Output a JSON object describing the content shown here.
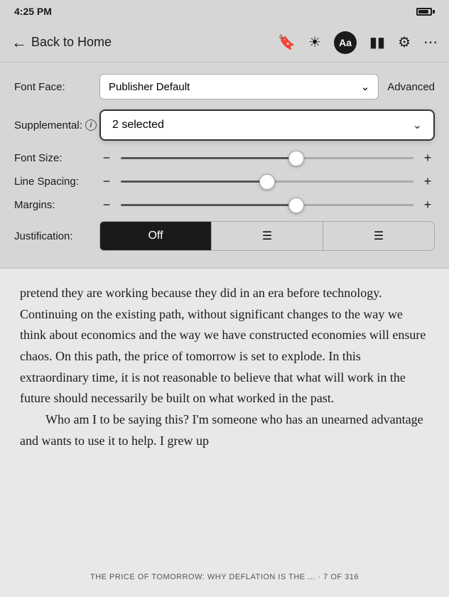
{
  "statusBar": {
    "time": "4:25 PM"
  },
  "navBar": {
    "backLabel": "Back to Home",
    "icons": {
      "bookmark": "🏷",
      "brightness": "☀",
      "fontAa": "Aa",
      "chart": "📊",
      "settings": "⚙",
      "more": "•••"
    }
  },
  "settings": {
    "fontFaceLabel": "Font Face:",
    "fontFaceValue": "Publisher Default",
    "advancedLabel": "Advanced",
    "supplementalLabel": "Supplemental:",
    "supplementalValue": "2 selected",
    "fontSizeLabel": "Font Size:",
    "lineSpacingLabel": "Line Spacing:",
    "marginsLabel": "Margins:",
    "justificationLabel": "Justification:",
    "sliders": {
      "fontSize": 0.6,
      "lineSpacing": 0.5,
      "margins": 0.6
    },
    "justificationOptions": [
      "Off",
      "≡",
      "≡"
    ],
    "activeJustification": 0
  },
  "reading": {
    "text1": "pretend they are working because they did in an era before technology. Continuing on the existing path, without significant changes to the way we think about economics and the way we have constructed economies will ensure chaos. On this path, the price of tomorrow is set to explode. In this extraordinary time, it is not reasonable to believe that what will work in the future should necessarily be built on what worked in the past.",
    "text2": "Who am I to be saying this? I'm someone who has an unearned advantage and wants to use it to help. I grew up",
    "footer": "THE PRICE OF TOMORROW: WHY DEFLATION IS THE ... · 7 OF 316"
  }
}
